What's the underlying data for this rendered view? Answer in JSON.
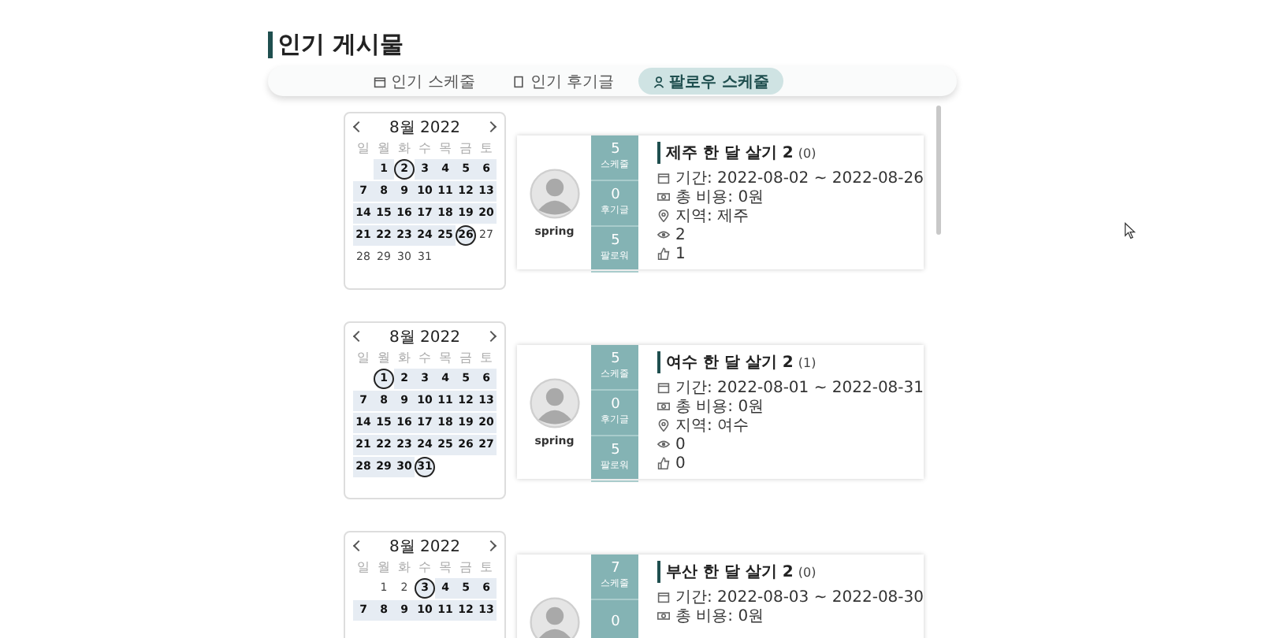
{
  "page_title": "인기 게시물",
  "tabs": [
    {
      "label": "인기 스케줄",
      "kind": "calendar",
      "selected": false
    },
    {
      "label": "인기 후기글",
      "kind": "document",
      "selected": false
    },
    {
      "label": "팔로우 스케줄",
      "kind": "person",
      "selected": true
    }
  ],
  "posts": [
    {
      "calendar": {
        "month": "8월 2022",
        "weekdays": [
          "일",
          "월",
          "화",
          "수",
          "목",
          "금",
          "토"
        ],
        "weeks": [
          [
            {
              "day": "1",
              "in_range": true,
              "marked": false
            },
            {
              "day": "2",
              "in_range": true,
              "marked": true
            },
            {
              "day": "3",
              "in_range": true,
              "marked": false
            },
            {
              "day": "4",
              "in_range": true,
              "marked": false
            },
            {
              "day": "5",
              "in_range": true,
              "marked": false
            },
            {
              "day": "6",
              "in_range": true,
              "marked": false
            }
          ],
          [
            {
              "day": "7",
              "in_range": true,
              "marked": false
            },
            {
              "day": "8",
              "in_range": true,
              "marked": false
            },
            {
              "day": "9",
              "in_range": true,
              "marked": false
            },
            {
              "day": "10",
              "in_range": true,
              "marked": false
            },
            {
              "day": "11",
              "in_range": true,
              "marked": false
            },
            {
              "day": "12",
              "in_range": true,
              "marked": false
            },
            {
              "day": "13",
              "in_range": true,
              "marked": false
            }
          ],
          [
            {
              "day": "14",
              "in_range": true,
              "marked": false
            },
            {
              "day": "15",
              "in_range": true,
              "marked": false
            },
            {
              "day": "16",
              "in_range": true,
              "marked": false
            },
            {
              "day": "17",
              "in_range": true,
              "marked": false
            },
            {
              "day": "18",
              "in_range": true,
              "marked": false
            },
            {
              "day": "19",
              "in_range": true,
              "marked": false
            },
            {
              "day": "20",
              "in_range": true,
              "marked": false
            }
          ],
          [
            {
              "day": "21",
              "in_range": true,
              "marked": false
            },
            {
              "day": "22",
              "in_range": true,
              "marked": false
            },
            {
              "day": "23",
              "in_range": true,
              "marked": false
            },
            {
              "day": "24",
              "in_range": true,
              "marked": false
            },
            {
              "day": "25",
              "in_range": true,
              "marked": false
            },
            {
              "day": "26",
              "in_range": true,
              "marked": true
            },
            {
              "day": "27",
              "in_range": false,
              "marked": false
            }
          ],
          [
            {
              "day": "28",
              "in_range": false,
              "marked": false
            },
            {
              "day": "29",
              "in_range": false,
              "marked": false
            },
            {
              "day": "30",
              "in_range": false,
              "marked": false
            },
            {
              "day": "31",
              "in_range": false,
              "marked": false
            }
          ]
        ]
      },
      "user": "spring",
      "stats": [
        {
          "count": "5",
          "label": "스케줄"
        },
        {
          "count": "0",
          "label": "후기글"
        },
        {
          "count": "5",
          "label": "팔로워"
        }
      ],
      "title": "제주 한 달 살기 2",
      "comments": "(0)",
      "info": [
        {
          "kind": "period",
          "text": "기간: 2022-08-02 ~ 2022-08-26"
        },
        {
          "kind": "cost",
          "text": "총 비용: 0원"
        },
        {
          "kind": "region",
          "text": "지역: 제주"
        },
        {
          "kind": "views",
          "text": "2"
        },
        {
          "kind": "likes",
          "text": "1"
        }
      ]
    },
    {
      "calendar": {
        "month": "8월 2022",
        "weekdays": [
          "일",
          "월",
          "화",
          "수",
          "목",
          "금",
          "토"
        ],
        "weeks": [
          [
            {
              "day": "1",
              "in_range": true,
              "marked": true
            },
            {
              "day": "2",
              "in_range": true,
              "marked": false
            },
            {
              "day": "3",
              "in_range": true,
              "marked": false
            },
            {
              "day": "4",
              "in_range": true,
              "marked": false
            },
            {
              "day": "5",
              "in_range": true,
              "marked": false
            },
            {
              "day": "6",
              "in_range": true,
              "marked": false
            }
          ],
          [
            {
              "day": "7",
              "in_range": true,
              "marked": false
            },
            {
              "day": "8",
              "in_range": true,
              "marked": false
            },
            {
              "day": "9",
              "in_range": true,
              "marked": false
            },
            {
              "day": "10",
              "in_range": true,
              "marked": false
            },
            {
              "day": "11",
              "in_range": true,
              "marked": false
            },
            {
              "day": "12",
              "in_range": true,
              "marked": false
            },
            {
              "day": "13",
              "in_range": true,
              "marked": false
            }
          ],
          [
            {
              "day": "14",
              "in_range": true,
              "marked": false
            },
            {
              "day": "15",
              "in_range": true,
              "marked": false
            },
            {
              "day": "16",
              "in_range": true,
              "marked": false
            },
            {
              "day": "17",
              "in_range": true,
              "marked": false
            },
            {
              "day": "18",
              "in_range": true,
              "marked": false
            },
            {
              "day": "19",
              "in_range": true,
              "marked": false
            },
            {
              "day": "20",
              "in_range": true,
              "marked": false
            }
          ],
          [
            {
              "day": "21",
              "in_range": true,
              "marked": false
            },
            {
              "day": "22",
              "in_range": true,
              "marked": false
            },
            {
              "day": "23",
              "in_range": true,
              "marked": false
            },
            {
              "day": "24",
              "in_range": true,
              "marked": false
            },
            {
              "day": "25",
              "in_range": true,
              "marked": false
            },
            {
              "day": "26",
              "in_range": true,
              "marked": false
            },
            {
              "day": "27",
              "in_range": true,
              "marked": false
            }
          ],
          [
            {
              "day": "28",
              "in_range": true,
              "marked": false
            },
            {
              "day": "29",
              "in_range": true,
              "marked": false
            },
            {
              "day": "30",
              "in_range": true,
              "marked": false
            },
            {
              "day": "31",
              "in_range": true,
              "marked": true
            }
          ]
        ]
      },
      "user": "spring",
      "stats": [
        {
          "count": "5",
          "label": "스케줄"
        },
        {
          "count": "0",
          "label": "후기글"
        },
        {
          "count": "5",
          "label": "팔로워"
        }
      ],
      "title": "여수 한 달 살기 2",
      "comments": "(1)",
      "info": [
        {
          "kind": "period",
          "text": "기간: 2022-08-01 ~ 2022-08-31"
        },
        {
          "kind": "cost",
          "text": "총 비용: 0원"
        },
        {
          "kind": "region",
          "text": "지역: 여수"
        },
        {
          "kind": "views",
          "text": "0"
        },
        {
          "kind": "likes",
          "text": "0"
        }
      ]
    },
    {
      "calendar": {
        "month": "8월 2022",
        "weekdays": [
          "일",
          "월",
          "화",
          "수",
          "목",
          "금",
          "토"
        ],
        "weeks": [
          [
            {
              "day": "1",
              "in_range": false,
              "marked": false
            },
            {
              "day": "2",
              "in_range": false,
              "marked": false
            },
            {
              "day": "3",
              "in_range": true,
              "marked": true
            },
            {
              "day": "4",
              "in_range": true,
              "marked": false
            },
            {
              "day": "5",
              "in_range": true,
              "marked": false
            },
            {
              "day": "6",
              "in_range": true,
              "marked": false
            }
          ],
          [
            {
              "day": "7",
              "in_range": true,
              "marked": false
            },
            {
              "day": "8",
              "in_range": true,
              "marked": false
            },
            {
              "day": "9",
              "in_range": true,
              "marked": false
            },
            {
              "day": "10",
              "in_range": true,
              "marked": false
            },
            {
              "day": "11",
              "in_range": true,
              "marked": false
            },
            {
              "day": "12",
              "in_range": true,
              "marked": false
            },
            {
              "day": "13",
              "in_range": true,
              "marked": false
            }
          ]
        ]
      },
      "stats": [
        {
          "count": "7",
          "label": "스케줄"
        },
        {
          "count": "0"
        }
      ],
      "title": "부산 한 달 살기 2",
      "comments": "(0)",
      "info": [
        {
          "kind": "period",
          "text": "기간: 2022-08-03 ~ 2022-08-30"
        },
        {
          "kind": "cost",
          "text": "총 비용: 0원"
        }
      ]
    }
  ]
}
